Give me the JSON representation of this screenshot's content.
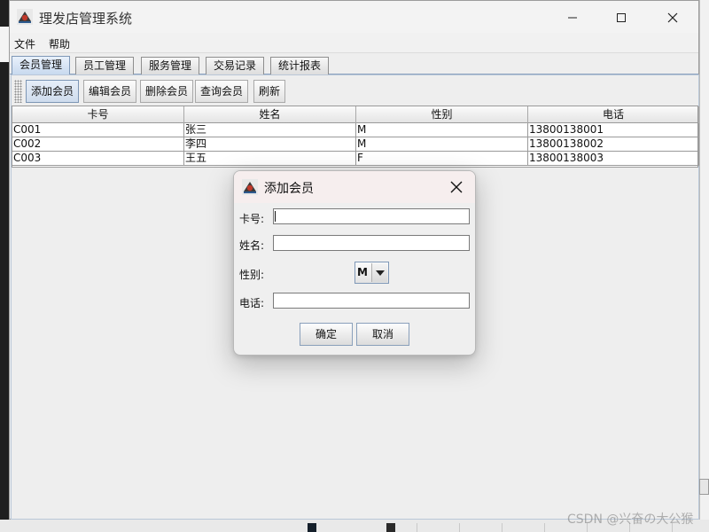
{
  "app": {
    "title": "理发店管理系统",
    "window_controls": [
      "minimize",
      "maximize",
      "close"
    ]
  },
  "menu": {
    "items": [
      "文件",
      "帮助"
    ]
  },
  "tabs": [
    {
      "label": "会员管理",
      "active": true
    },
    {
      "label": "员工管理",
      "active": false
    },
    {
      "label": "服务管理",
      "active": false
    },
    {
      "label": "交易记录",
      "active": false
    },
    {
      "label": "统计报表",
      "active": false
    }
  ],
  "toolbar": {
    "buttons": [
      "添加会员",
      "编辑会员",
      "删除会员",
      "查询会员",
      "刷新"
    ]
  },
  "table": {
    "columns": [
      "卡号",
      "姓名",
      "性别",
      "电话"
    ],
    "rows": [
      [
        "C001",
        "张三",
        "M",
        "13800138001"
      ],
      [
        "C002",
        "李四",
        "M",
        "13800138002"
      ],
      [
        "C003",
        "王五",
        "F",
        "13800138003"
      ]
    ]
  },
  "dialog": {
    "title": "添加会员",
    "fields": {
      "card_label": "卡号:",
      "card_value": "",
      "name_label": "姓名:",
      "name_value": "",
      "gender_label": "性别:",
      "gender_value": "M",
      "phone_label": "电话:",
      "phone_value": ""
    },
    "ok_label": "确定",
    "cancel_label": "取消"
  },
  "watermark": "CSDN @兴奋の大公猴",
  "colors": {
    "active_tab": "#c6d8ee",
    "accent_border": "#7f98b7"
  }
}
